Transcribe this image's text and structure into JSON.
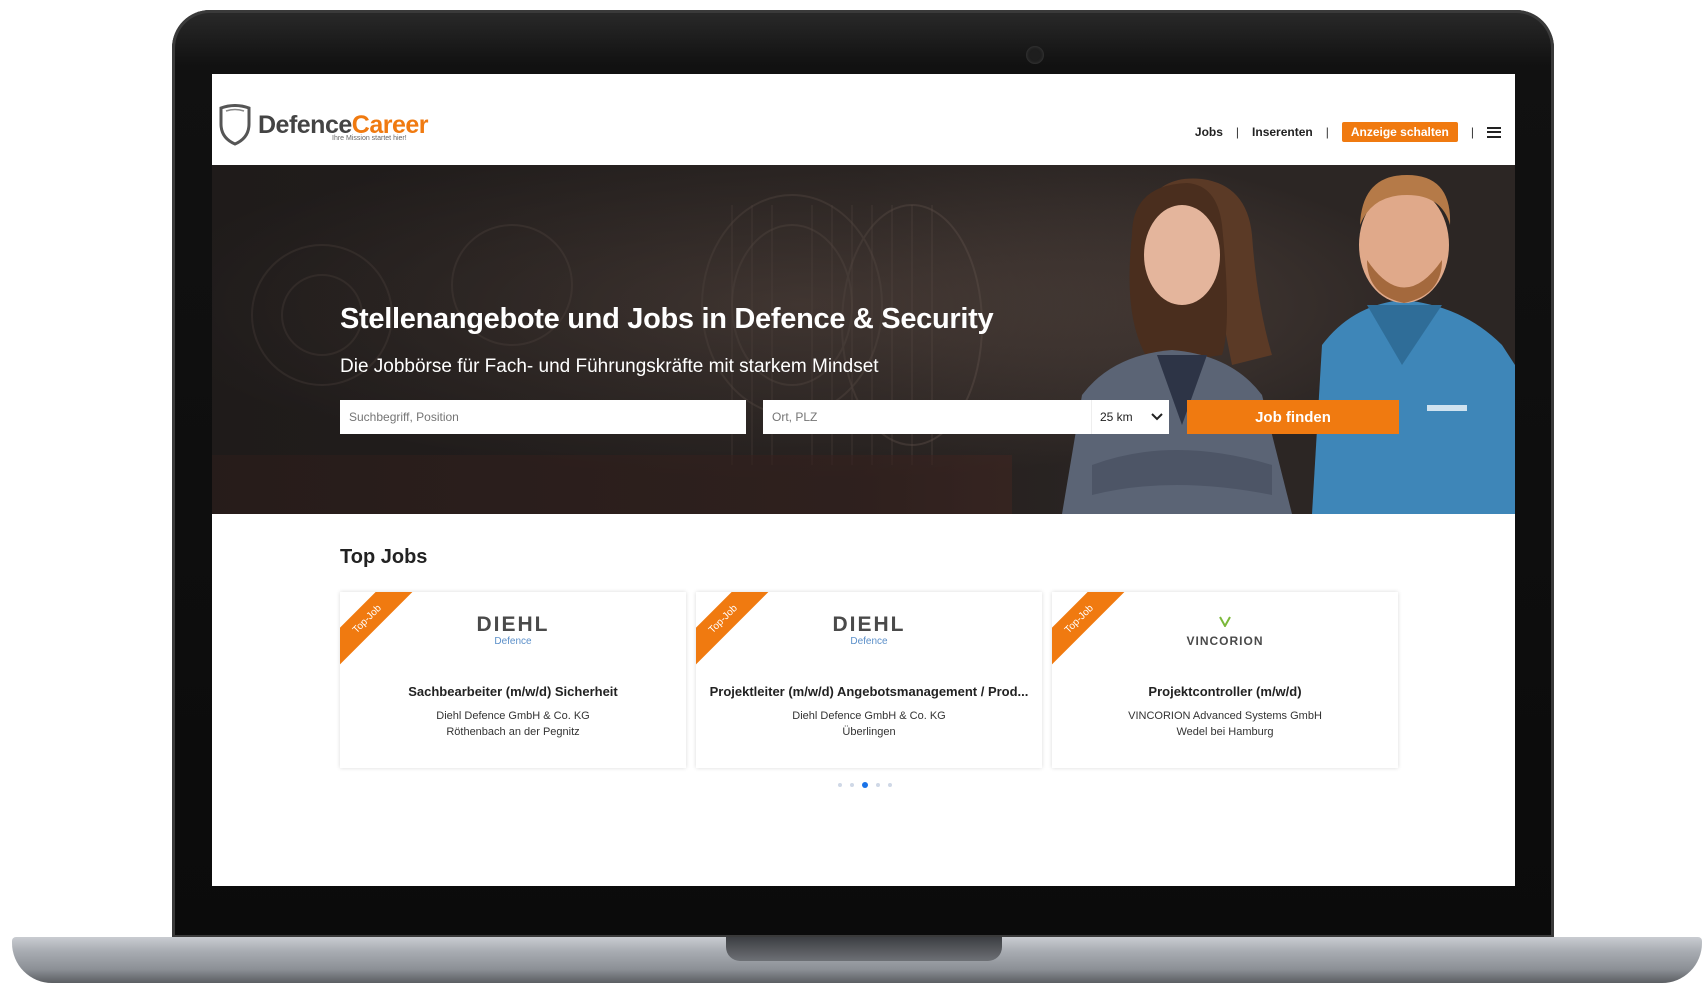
{
  "brand": {
    "name_part1": "Defence",
    "name_part2": "Career",
    "tagline": "Ihre Mission startet hier!",
    "accent_color": "#f07a10"
  },
  "nav": {
    "items": [
      "Jobs",
      "Inserenten"
    ],
    "cta_label": "Anzeige schalten",
    "menu_icon": "hamburger-menu-icon"
  },
  "hero": {
    "title": "Stellenangebote und Jobs in Defence & Security",
    "subtitle": "Die Jobbörse für Fach- und Führungskräfte mit starkem Mindset",
    "search_placeholder": "Suchbegriff, Position",
    "location_placeholder": "Ort, PLZ",
    "radius_value": "25 km",
    "submit_label": "Job finden"
  },
  "top_jobs": {
    "heading": "Top Jobs",
    "ribbon_label": "Top-Job",
    "jobs": [
      {
        "logo_main": "DIEHL",
        "logo_sub": "Defence",
        "title": "Sachbearbeiter (m/w/d) Sicherheit",
        "company": "Diehl Defence GmbH & Co. KG",
        "location": "Röthenbach an der Pegnitz"
      },
      {
        "logo_main": "DIEHL",
        "logo_sub": "Defence",
        "title": "Projektleiter (m/w/d) Angebotsmanagement / Prod...",
        "company": "Diehl Defence GmbH & Co. KG",
        "location": "Überlingen"
      },
      {
        "logo_main": "VINCORION",
        "logo_sub": "",
        "title": "Projektcontroller (m/w/d)",
        "company": "VINCORION Advanced Systems GmbH",
        "location": "Wedel bei Hamburg"
      }
    ],
    "carousel_pages": 5,
    "carousel_active": 3
  }
}
